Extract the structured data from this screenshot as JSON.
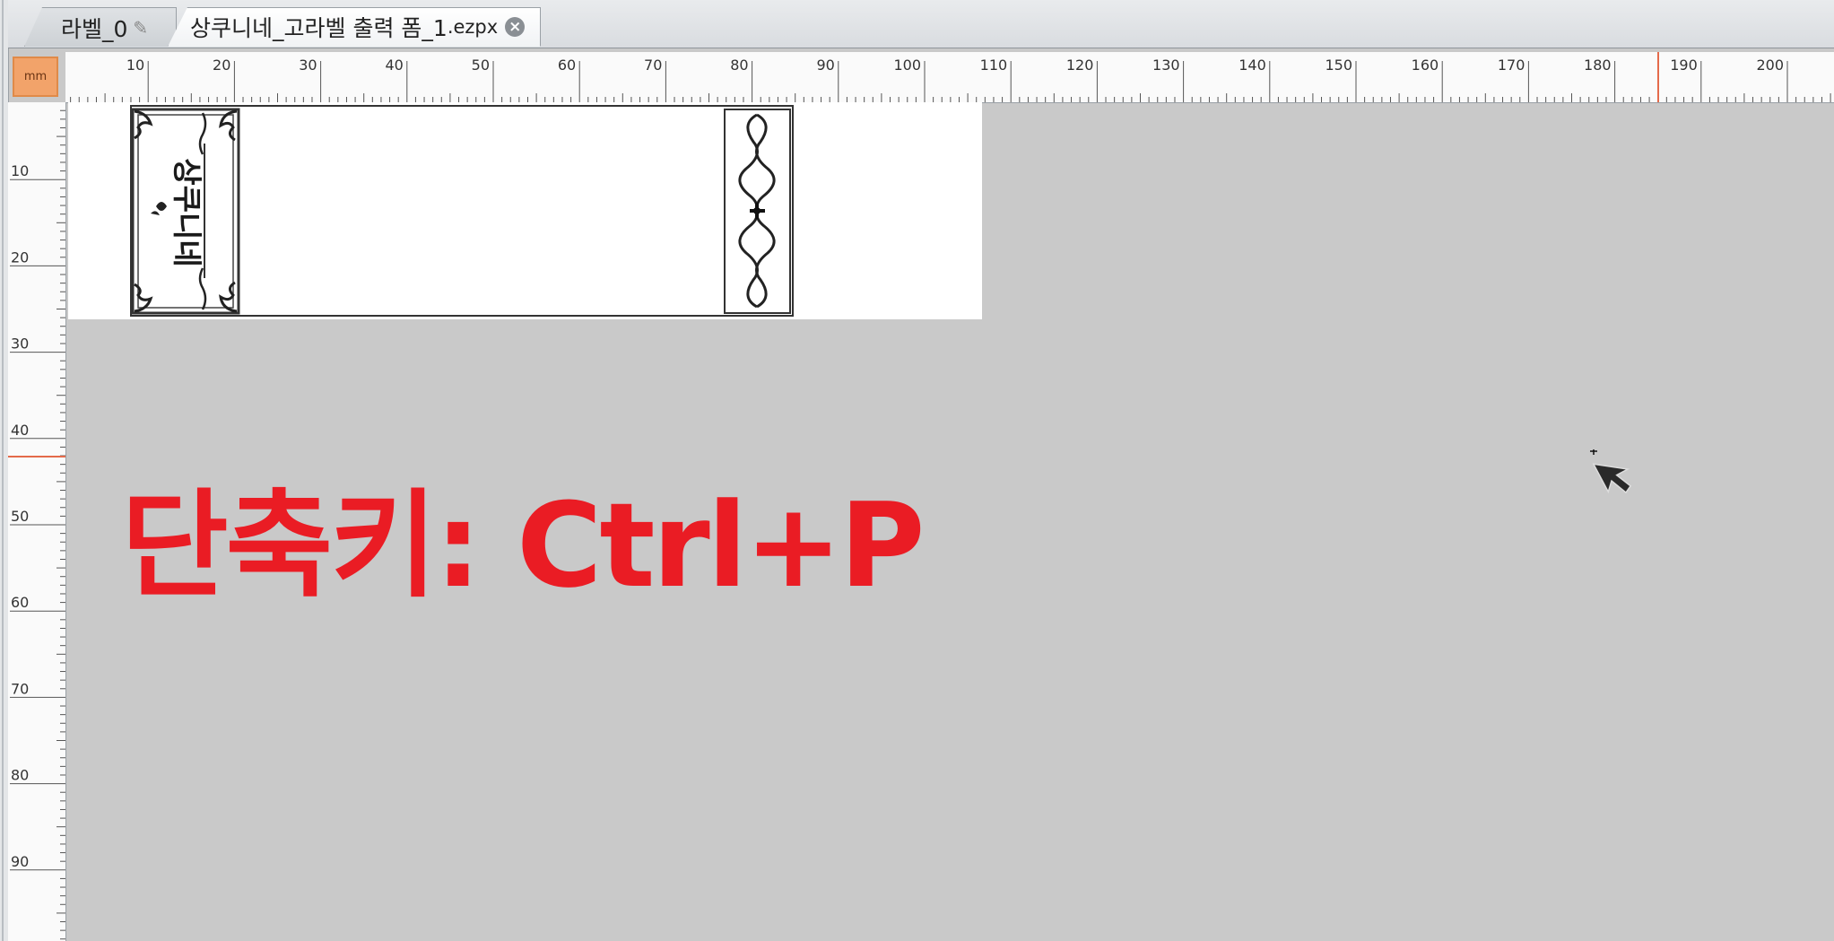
{
  "tabs": [
    {
      "label": "라벨_0",
      "active": false
    },
    {
      "label": "상쿠니네_고라벨 출력 폼_1",
      "ext": ".ezpx",
      "active": true
    }
  ],
  "ruler": {
    "unit": "mm",
    "horizontal_ticks": [
      "10",
      "20",
      "30",
      "40",
      "50",
      "60",
      "70",
      "80",
      "90",
      "100",
      "110",
      "120",
      "130",
      "140",
      "150",
      "160",
      "170",
      "180",
      "190",
      "200"
    ],
    "vertical_ticks": [
      "10",
      "20",
      "30",
      "40",
      "50",
      "60",
      "70",
      "80",
      "90"
    ]
  },
  "label": {
    "brand_text": "상쿠니네"
  },
  "overlay": {
    "shortcut_text": "단축키: Ctrl+P",
    "color": "#ea1c24"
  },
  "colors": {
    "unit_button": "#f2a36a",
    "ruler_marker": "#e46a4a"
  }
}
